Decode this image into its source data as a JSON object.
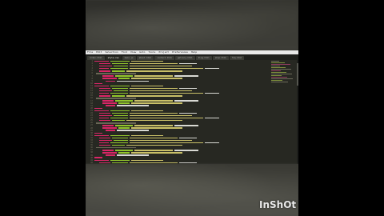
{
  "menu": [
    "File",
    "Edit",
    "Selection",
    "Find",
    "View",
    "Goto",
    "Tools",
    "Project",
    "Preferences",
    "Help"
  ],
  "tabs": [
    {
      "label": "index.html",
      "active": false
    },
    {
      "label": "style.css",
      "active": true
    },
    {
      "label": "main.js",
      "active": false
    },
    {
      "label": "about.html",
      "active": false
    },
    {
      "label": "contact.html",
      "active": false
    },
    {
      "label": "gallery.html",
      "active": false
    },
    {
      "label": "blog.html",
      "active": false
    },
    {
      "label": "shop.html",
      "active": false
    },
    {
      "label": "faq.html",
      "active": false
    }
  ],
  "code_start_line": 1,
  "code_lines_count": 42,
  "watermark": "InShOt",
  "colors": {
    "editor_bg": "#272822",
    "tag": "#f92672",
    "attr": "#a6e22e",
    "string": "#e6db74",
    "text": "#f8f8f2",
    "comment": "#75715e"
  }
}
